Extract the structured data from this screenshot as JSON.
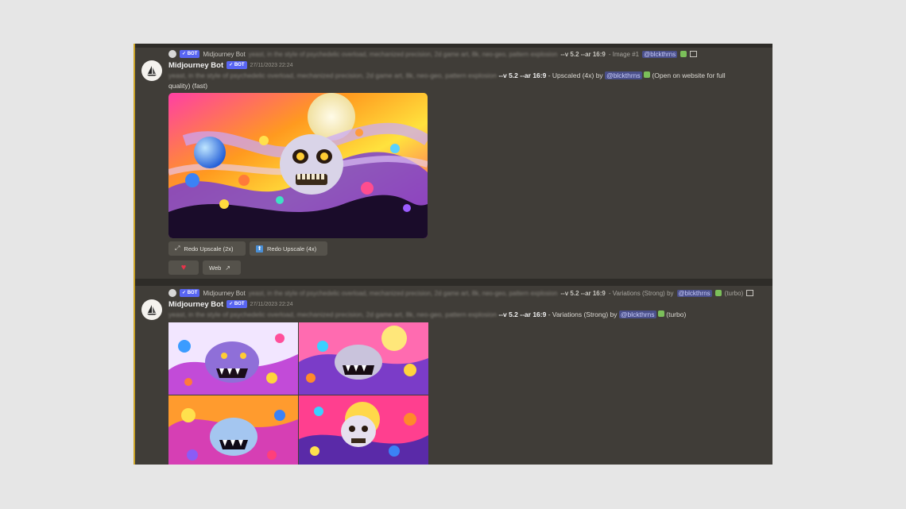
{
  "message1": {
    "reply": {
      "bot_badge": "✓ BOT",
      "username": "Midjourney Bot",
      "prompt_blurred": "yeast, in the style of psychedelic overload, mechanized precision, 2d game art, 8k, neo-geo, pattern explosion",
      "params": "--v 5.2 --ar 16:9",
      "suffix": "- Image #1",
      "mention": "@blckthrns"
    },
    "username": "Midjourney Bot",
    "bot_badge": "✓ BOT",
    "timestamp": "27/11/2023 22:24",
    "content": {
      "prompt_blurred": "yeast, in the style of psychedelic overload, mechanized precision, 2d game art, 8k, neo-geo, pattern explosion",
      "params": "--v 5.2 --ar 16:9",
      "action": "- Upscaled (4x) by",
      "mention": "@blckthrns",
      "tail": "(Open on website for full quality) (fast)"
    },
    "buttons": {
      "redo_2x": "Redo Upscale (2x)",
      "redo_4x": "Redo Upscale (4x)",
      "web": "Web"
    }
  },
  "message2": {
    "reply": {
      "bot_badge": "✓ BOT",
      "username": "Midjourney Bot",
      "prompt_blurred": "yeast, in the style of psychedelic overload, mechanized precision, 2d game art, 8k, neo-geo, pattern explosion",
      "params": "--v 5.2 --ar 16:9",
      "suffix": "- Variations (Strong) by",
      "mention": "@blckthrns",
      "tail": "(turbo)"
    },
    "username": "Midjourney Bot",
    "bot_badge": "✓ BOT",
    "timestamp": "27/11/2023 22:24",
    "content": {
      "prompt_blurred": "yeast, in the style of psychedelic overload, mechanized precision, 2d game art, 8k, neo-geo, pattern explosion",
      "params": "--v 5.2 --ar 16:9",
      "action": "- Variations (Strong) by",
      "mention": "@blckthrns",
      "tail": "(turbo)"
    }
  },
  "colors": {
    "background": "#403d38",
    "accent_border": "#c9a227",
    "bot_badge": "#5865f2",
    "mention_bg": "#4a4f8a"
  }
}
